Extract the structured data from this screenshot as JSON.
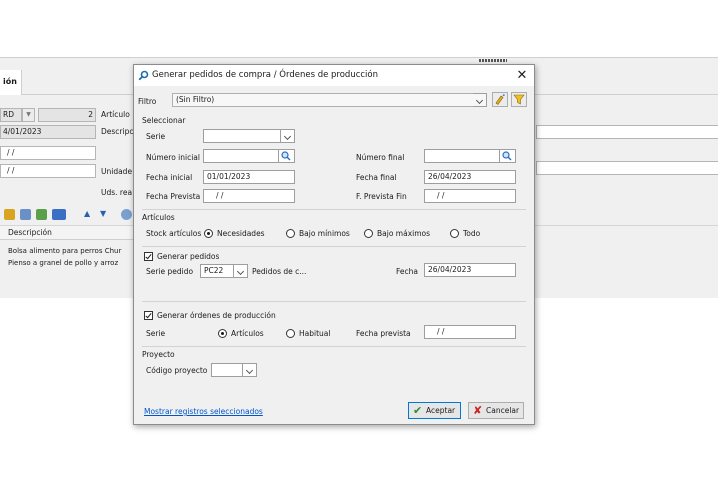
{
  "background": {
    "tab_label": "ión",
    "code_field": "RD",
    "number_field": "2",
    "date_field": "4/01/2023",
    "empty_date_1": "/ /",
    "empty_date_2": "/ /",
    "label_articulo": "Artículo",
    "label_descripcion": "Descripc",
    "label_unidades": "Unidade",
    "label_uds": "Uds. rea",
    "grid_header": "Descripción",
    "grid_rows": [
      "Bolsa alimento para perros Chur",
      "Pienso a granel de pollo y arroz"
    ]
  },
  "dialog": {
    "title": "Generar pedidos de compra / Órdenes de producción",
    "close_glyph": "✕",
    "filtro_label": "Filtro",
    "filtro_value": "(Sin Filtro)",
    "seleccionar": {
      "section": "Seleccionar",
      "serie_label": "Serie",
      "serie_value": "",
      "numero_inicial_label": "Número inicial",
      "numero_inicial_value": "",
      "numero_final_label": "Número final",
      "numero_final_value": "",
      "fecha_inicial_label": "Fecha inicial",
      "fecha_inicial_value": "01/01/2023",
      "fecha_final_label": "Fecha final",
      "fecha_final_value": "26/04/2023",
      "fecha_prevista_label": "Fecha Prevista",
      "fecha_prevista_value": "/ /",
      "f_prevista_fin_label": "F. Prevista Fin",
      "f_prevista_fin_value": "/ /"
    },
    "articulos": {
      "section": "Artículos",
      "stock_label": "Stock artículos",
      "options": [
        "Necesidades",
        "Bajo mínimos",
        "Bajo máximos",
        "Todo"
      ],
      "selected": "Necesidades"
    },
    "pedidos": {
      "checkbox_label": "Generar pedidos",
      "checked": true,
      "serie_pedido_label": "Serie pedido",
      "serie_pedido_value": "PC22",
      "serie_pedido_desc": "Pedidos de c...",
      "fecha_label": "Fecha",
      "fecha_value": "26/04/2023"
    },
    "ordenes": {
      "checkbox_label": "Generar órdenes de producción",
      "checked": true,
      "serie_label": "Serie",
      "options": [
        "Artículos",
        "Habitual"
      ],
      "selected": "Artículos",
      "fecha_prevista_label": "Fecha prevista",
      "fecha_prevista_value": "/ /"
    },
    "proyecto": {
      "section": "Proyecto",
      "codigo_label": "Código proyecto",
      "codigo_value": ""
    },
    "footer": {
      "link": "Mostrar registros seleccionados",
      "accept_label": "Aceptar",
      "cancel_label": "Cancelar"
    },
    "colors": {
      "accent": "#0078d7",
      "link": "#0055cc",
      "accept_check": "#2e8b2e",
      "cancel_x": "#cc2222"
    }
  }
}
